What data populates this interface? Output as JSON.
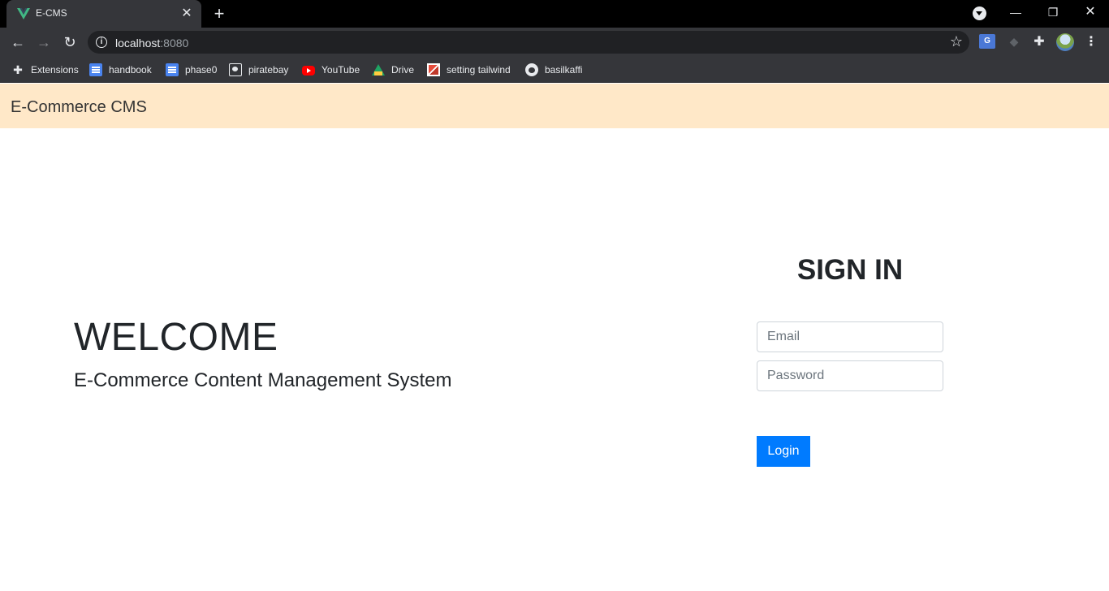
{
  "browser": {
    "tab_title": "E-CMS",
    "url_host": "localhost",
    "url_port": ":8080",
    "bookmarks": [
      {
        "label": "Extensions",
        "icon": "puzzle-icon"
      },
      {
        "label": "handbook",
        "icon": "doc-icon"
      },
      {
        "label": "phase0",
        "icon": "doc-icon"
      },
      {
        "label": "piratebay",
        "icon": "piratebay-icon"
      },
      {
        "label": "YouTube",
        "icon": "youtube-icon"
      },
      {
        "label": "Drive",
        "icon": "drive-icon"
      },
      {
        "label": "setting tailwind",
        "icon": "s-icon"
      },
      {
        "label": "basilkaffi",
        "icon": "github-icon"
      }
    ]
  },
  "navbar": {
    "brand": "E-Commerce CMS",
    "background": "#ffe8c8"
  },
  "hero": {
    "title": "WELCOME",
    "subtitle": "E-Commerce Content Management System"
  },
  "signin": {
    "title": "SIGN IN",
    "email_placeholder": "Email",
    "password_placeholder": "Password",
    "login_label": "Login",
    "accent": "#007bff"
  }
}
